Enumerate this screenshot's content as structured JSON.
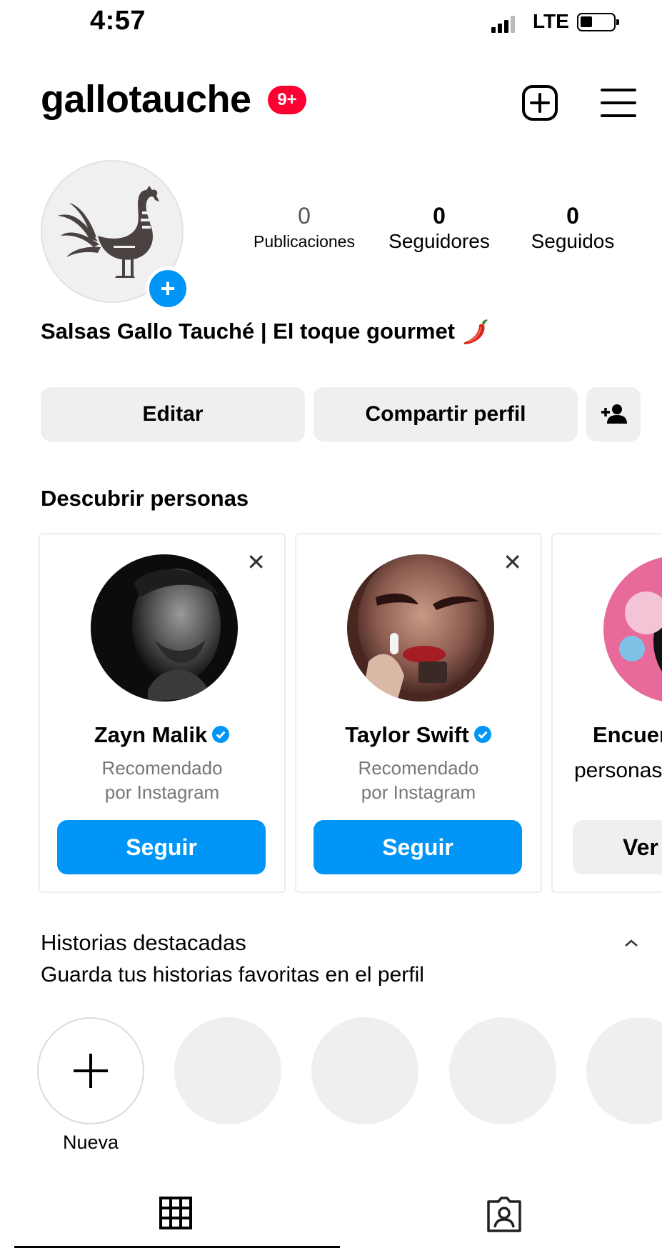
{
  "status_bar": {
    "time": "4:57",
    "network": "LTE"
  },
  "header": {
    "username": "gallotauche",
    "notification_badge": "9+",
    "new_post_icon": "plus-square-icon",
    "menu_icon": "hamburger-icon"
  },
  "profile": {
    "stats": [
      {
        "value": "0",
        "label": "Publicaciones"
      },
      {
        "value": "0",
        "label": "Seguidores"
      },
      {
        "value": "0",
        "label": "Seguidos"
      }
    ],
    "bio": "Salsas Gallo Tauché | El toque gourmet",
    "bio_emoji": "🌶️"
  },
  "actions": {
    "edit_label": "Editar",
    "share_label": "Compartir perfil"
  },
  "discover": {
    "title": "Descubrir personas",
    "cards": [
      {
        "name": "Zayn Malik",
        "subtitle_line1": "Recomendado",
        "subtitle_line2": "por Instagram",
        "button": "Seguir"
      },
      {
        "name": "Taylor Swift",
        "subtitle_line1": "Recomendado",
        "subtitle_line2": "por Instagram",
        "button": "Seguir"
      },
      {
        "name": "Encuentra",
        "subtitle_line1": "personas",
        "button": "Ver"
      }
    ]
  },
  "highlights": {
    "title": "Historias destacadas",
    "subtitle": "Guarda tus historias favoritas en el perfil",
    "new_label": "Nueva"
  },
  "colors": {
    "accent": "#0095f6",
    "badge": "#ff0033",
    "button_bg": "#efefef"
  }
}
